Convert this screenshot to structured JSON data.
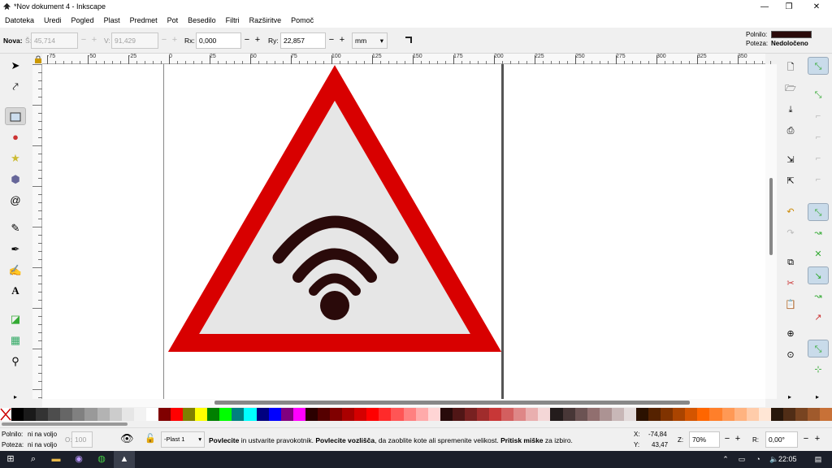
{
  "window": {
    "title": "*Nov dokument 4 - Inkscape",
    "min": "—",
    "max": "❐",
    "close": "✕"
  },
  "menu": [
    "Datoteka",
    "Uredi",
    "Pogled",
    "Plast",
    "Predmet",
    "Pot",
    "Besedilo",
    "Filtri",
    "Razširitve",
    "Pomoč"
  ],
  "controls": {
    "nova": "Nova:",
    "w_label": "Š:",
    "w_value": "45,714",
    "h_label": "V:",
    "h_value": "91,429",
    "rx_label": "Rx:",
    "rx_value": "0,000",
    "ry_label": "Ry:",
    "ry_value": "22,857",
    "unit": "mm",
    "fill_label": "Polnilo:",
    "stroke_label": "Poteza:",
    "stroke_value": "Nedoločeno",
    "fill_color": "#2a0a0a"
  },
  "ruler_ticks": [
    "-75",
    "-50",
    "-25",
    "0",
    "25",
    "50",
    "75",
    "100",
    "125",
    "150",
    "175",
    "200",
    "225",
    "250",
    "275",
    "300",
    "325",
    "350"
  ],
  "drawing": {
    "triangle_border": "#d80000",
    "triangle_fill": "#e6e6e6",
    "wifi_color": "#2a0a0a"
  },
  "tools": [
    "select-arrow-icon",
    "node-edit-icon",
    "rectangle-icon",
    "circle-icon",
    "star-icon",
    "3d-box-icon",
    "spiral-icon",
    "pencil-icon",
    "pen-icon",
    "calligraphy-icon",
    "text-icon",
    "gradient-icon",
    "mesh-icon",
    "dropper-icon"
  ],
  "palette": [
    "#000000",
    "#1a1a1a",
    "#333333",
    "#4d4d4d",
    "#666666",
    "#808080",
    "#999999",
    "#b3b3b3",
    "#cccccc",
    "#e6e6e6",
    "#f2f2f2",
    "#ffffff",
    "#800000",
    "#ff0000",
    "#808000",
    "#ffff00",
    "#008000",
    "#00ff00",
    "#008080",
    "#00ffff",
    "#000080",
    "#0000ff",
    "#800080",
    "#ff00ff",
    "#2b0000",
    "#550000",
    "#800000",
    "#aa0000",
    "#d40000",
    "#ff0000",
    "#ff2a2a",
    "#ff5555",
    "#ff8080",
    "#ffaaaa",
    "#ffd5d5",
    "#280b0b",
    "#501616",
    "#782121",
    "#a02c2c",
    "#c83737",
    "#d35f5f",
    "#de8787",
    "#e9afaf",
    "#f4d7d7",
    "#241c1c",
    "#483737",
    "#6c5353",
    "#916f6f",
    "#ac9393",
    "#c8b7b7",
    "#e3dbdb",
    "#2b1100",
    "#552200",
    "#803300",
    "#aa4400",
    "#d45500",
    "#ff6600",
    "#ff7f2a",
    "#ff9955",
    "#ffb380",
    "#ffccaa",
    "#ffe6d5",
    "#28170b",
    "#502d16",
    "#784421",
    "#a05a2c",
    "#c87137"
  ],
  "status": {
    "fill_label": "Polnilo:",
    "fill_value": "ni na voljo",
    "stroke_label": "Poteza:",
    "stroke_value": "ni na voljo",
    "opacity_label": "O:",
    "opacity_value": "100",
    "layer": "-Plast 1",
    "msg_b1": "Povlecite",
    "msg_t1": " in ustvarite pravokotnik. ",
    "msg_b2": "Povlecite vozlišča",
    "msg_t2": ", da zaoblite kote ali spremenite velikost. ",
    "msg_b3": "Pritisk miške",
    "msg_t3": " za izbiro.",
    "x_label": "X:",
    "x_value": "-74,84",
    "y_label": "Y:",
    "y_value": "43,47",
    "zoom_label": "Z:",
    "zoom_value": "70%",
    "rot_label": "R:",
    "rot_value": "0,00°"
  },
  "taskbar": {
    "time": "22:05"
  }
}
